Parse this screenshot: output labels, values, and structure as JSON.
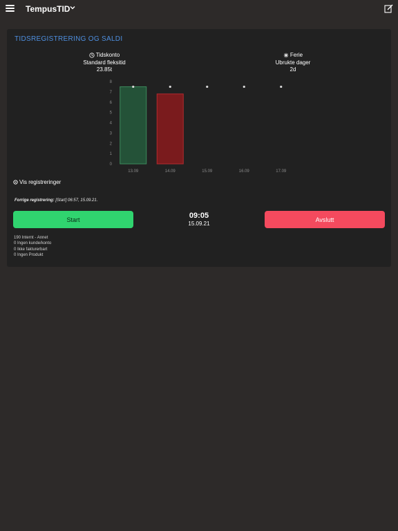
{
  "header": {
    "app_title": "TempusTID"
  },
  "card": {
    "title": "TIDSREGISTRERING OG SALDI",
    "left_stat": {
      "label": "Tidskonto",
      "subtitle": "Standard fleksitid",
      "value": "23.85t"
    },
    "right_stat": {
      "label": "Ferie",
      "subtitle": "Ubrukte dager",
      "value": "2d"
    },
    "vis_registreringer": "Vis registreringer",
    "last_registration": {
      "label": "Forrige registrering:",
      "value": "[Start] 06:57, 15.09.21."
    },
    "start_label": "Start",
    "stop_label": "Avslutt",
    "clock_time": "09:05",
    "clock_date": "15.09.21",
    "info_lines": [
      "190 Internt - Annet",
      "0 Ingen kunde/konto",
      "0 Ikke fakturerbart",
      "0 Ingen Produkt"
    ]
  },
  "chart_data": {
    "type": "bar",
    "categories": [
      "13.09",
      "14.09",
      "15.09",
      "16.09",
      "17.09"
    ],
    "series": [
      {
        "values": [
          7.5,
          6.8,
          0,
          0,
          0
        ]
      },
      {
        "values": [
          7.5,
          7.5,
          7.5,
          7.5,
          7.5
        ]
      }
    ],
    "bar_colors": [
      "#245238",
      "#7a1b1d",
      null,
      null,
      null
    ],
    "bar_borders": [
      "#3d8a5c",
      "#b32a2e",
      null,
      null,
      null
    ],
    "ylim": [
      0,
      8
    ],
    "yticks": [
      0,
      1,
      2,
      3,
      4,
      5,
      6,
      7,
      8
    ],
    "xlabel": "",
    "ylabel": "",
    "grid": false
  }
}
